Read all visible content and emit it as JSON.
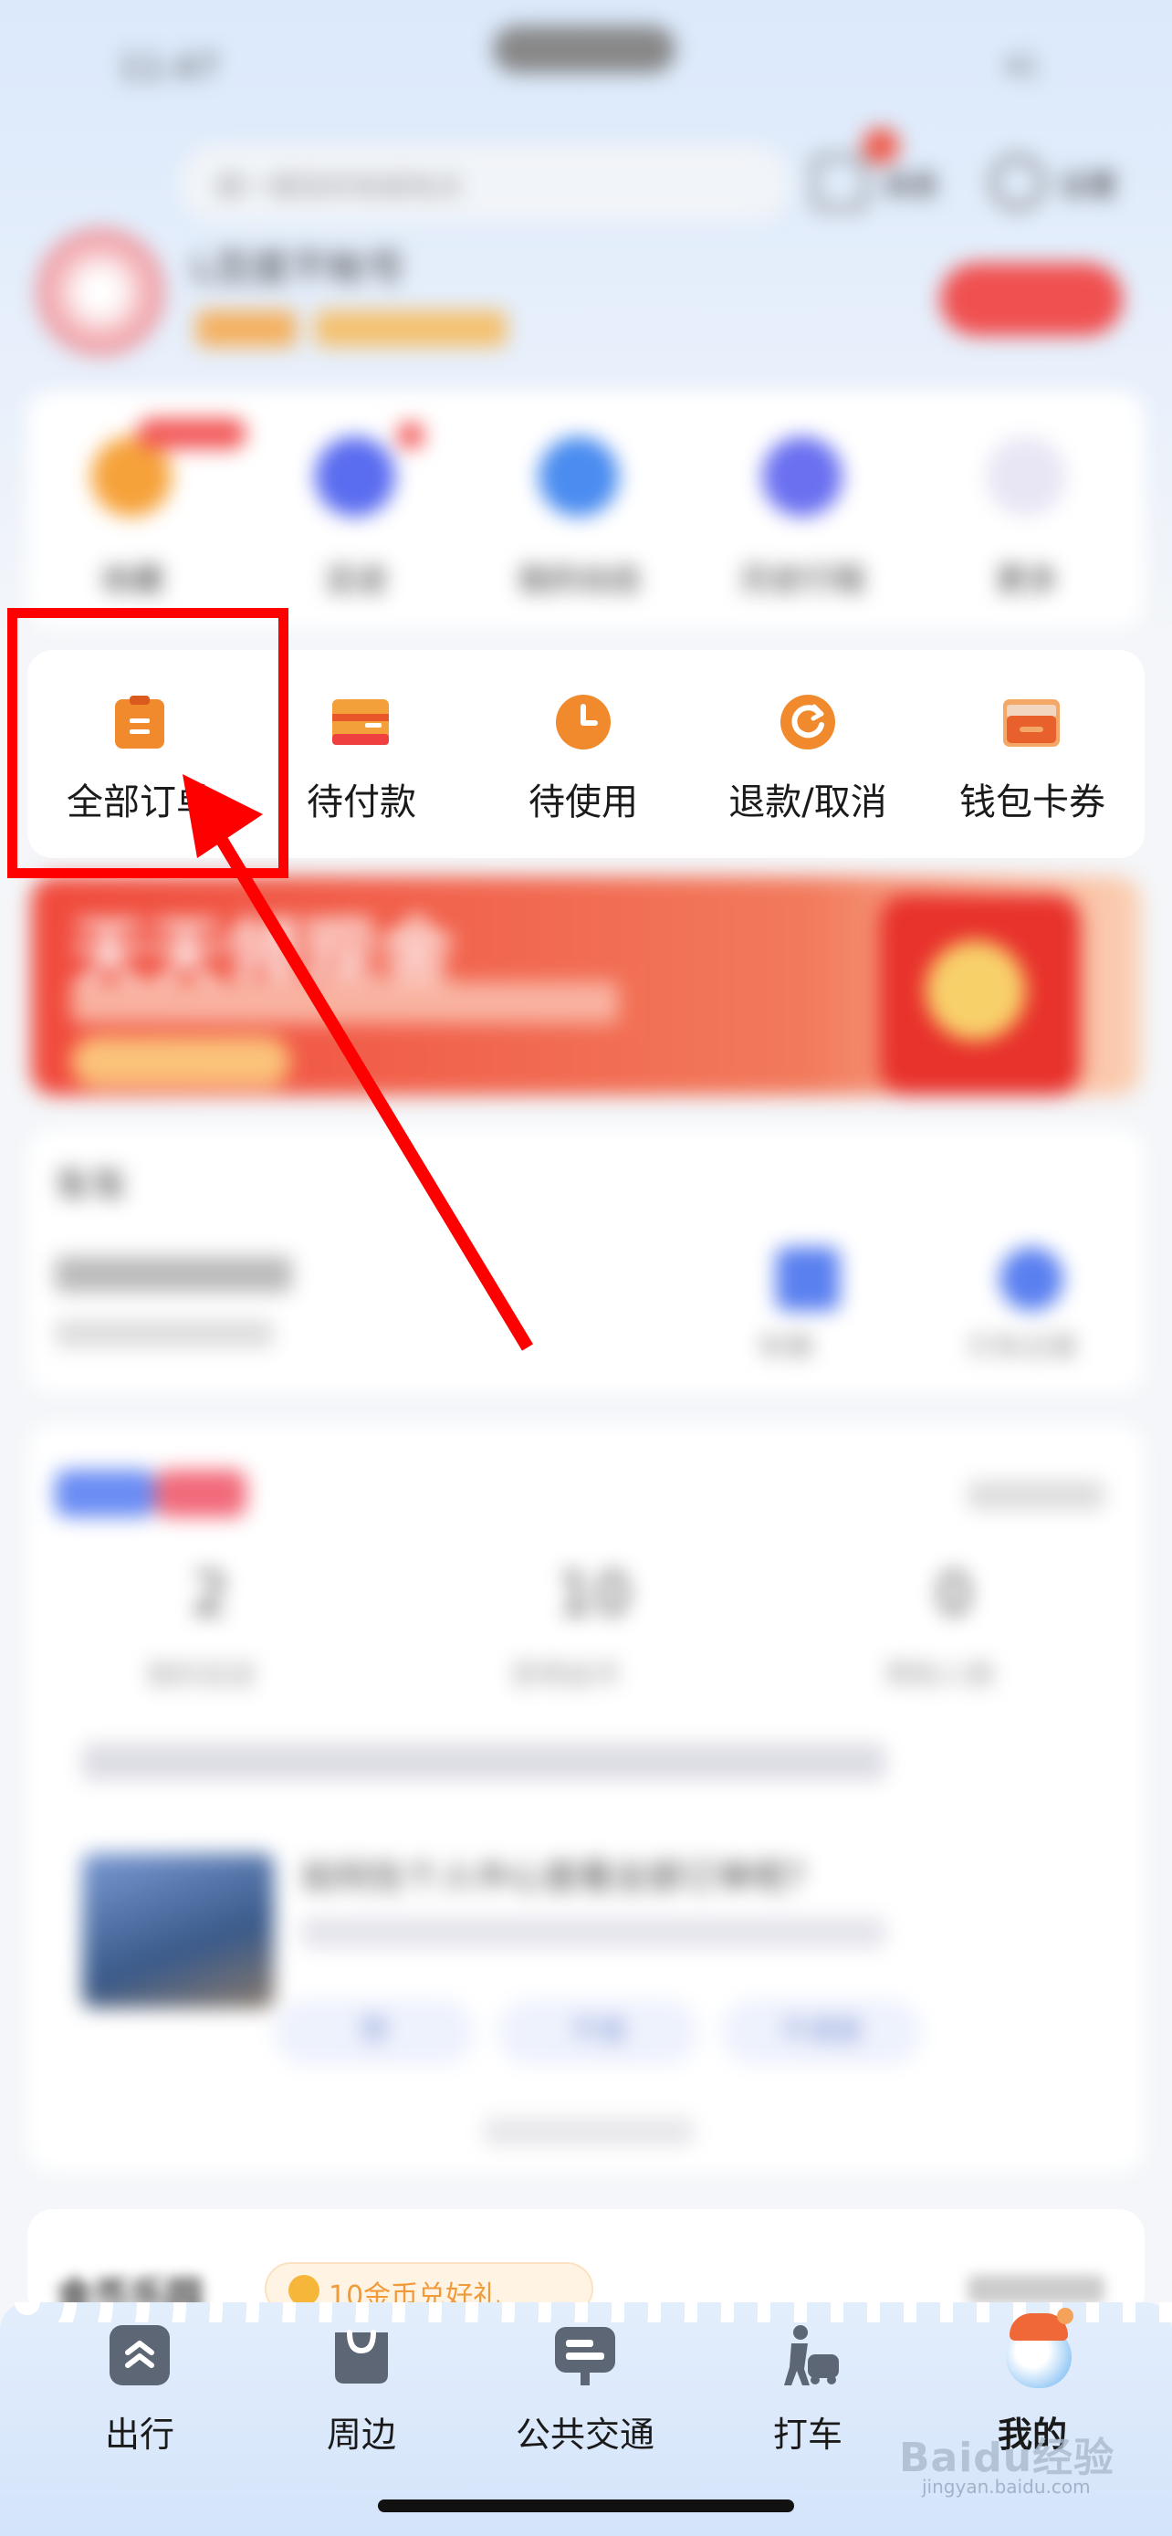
{
  "status_bar": {
    "time": "11:47",
    "battery": "41"
  },
  "search": {
    "placeholder": "搜一搜目的地或地点"
  },
  "header": {
    "messages_label": "消息",
    "settings_label": "设置"
  },
  "user": {
    "name": "L百度不帐号"
  },
  "quick_services": [
    {
      "label": "收藏"
    },
    {
      "label": "足迹"
    },
    {
      "label": "我的动态"
    },
    {
      "label": "历史行程"
    },
    {
      "label": "更多"
    }
  ],
  "orders": [
    {
      "label": "全部订单",
      "icon": "clipboard-icon"
    },
    {
      "label": "待付款",
      "icon": "card-icon"
    },
    {
      "label": "待使用",
      "icon": "clock-icon"
    },
    {
      "label": "退款/取消",
      "icon": "refresh-icon"
    },
    {
      "label": "钱包卡券",
      "icon": "wallet-icon"
    }
  ],
  "banner": {
    "title": "天天领现金"
  },
  "car_section": {
    "title": "车车",
    "actions": [
      {
        "label": "车辆"
      },
      {
        "label": "行车记录"
      }
    ]
  },
  "stats": [
    {
      "value": "2",
      "label": "我的足迹"
    },
    {
      "value": "10",
      "label": "获得金币"
    },
    {
      "value": "0",
      "label": "帮助人数"
    }
  ],
  "feed": {
    "title": "如何在个人中心查看全部订单呢?",
    "tags": [
      {
        "label": "赞"
      },
      {
        "label": "不错"
      },
      {
        "label": "不满意"
      }
    ]
  },
  "gold_section": {
    "title": "金币乐园",
    "badge": "10金币兑好礼"
  },
  "bottom_nav": [
    {
      "label": "出行",
      "icon": "chevron-up-icon"
    },
    {
      "label": "周边",
      "icon": "bag-icon"
    },
    {
      "label": "公共交通",
      "icon": "bus-stop-icon"
    },
    {
      "label": "打车",
      "icon": "taxi-icon"
    },
    {
      "label": "我的",
      "icon": "avatar-icon"
    }
  ],
  "watermark": "Baidu经验",
  "watermark_sub": "jingyan.baidu.com",
  "colors": {
    "highlight": "#ff0000",
    "order_icon": "#f08a2c",
    "banner": "#f06450"
  }
}
